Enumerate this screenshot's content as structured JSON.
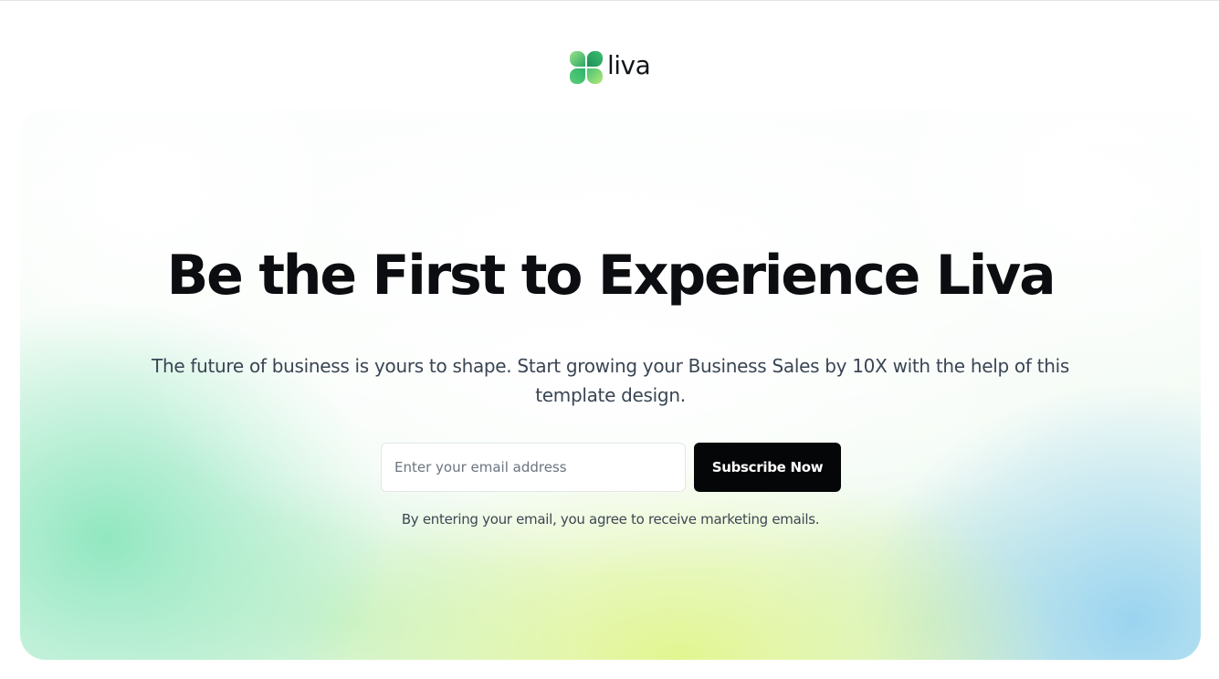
{
  "brand": {
    "name": "liva",
    "logo_icon": "four-leaf-clover-icon",
    "colors": {
      "leaf_light": "#7fdc8e",
      "leaf_dark": "#1f9c5d"
    }
  },
  "hero": {
    "headline": "Be the First to Experience Liva",
    "subtext": "The future of business is yours to shape. Start growing your Business Sales by 10X with the help of this template design.",
    "email_placeholder": "Enter your email address",
    "email_value": "",
    "subscribe_label": "Subscribe Now",
    "disclaimer": "By entering your email, you agree to receive marketing emails.",
    "colors": {
      "button_bg": "#050608",
      "button_text": "#ffffff",
      "headline": "#0b0d10",
      "gradient_green": "#8ce6be",
      "gradient_yellow": "#e2f68c",
      "gradient_blue": "#96d2f0"
    }
  }
}
